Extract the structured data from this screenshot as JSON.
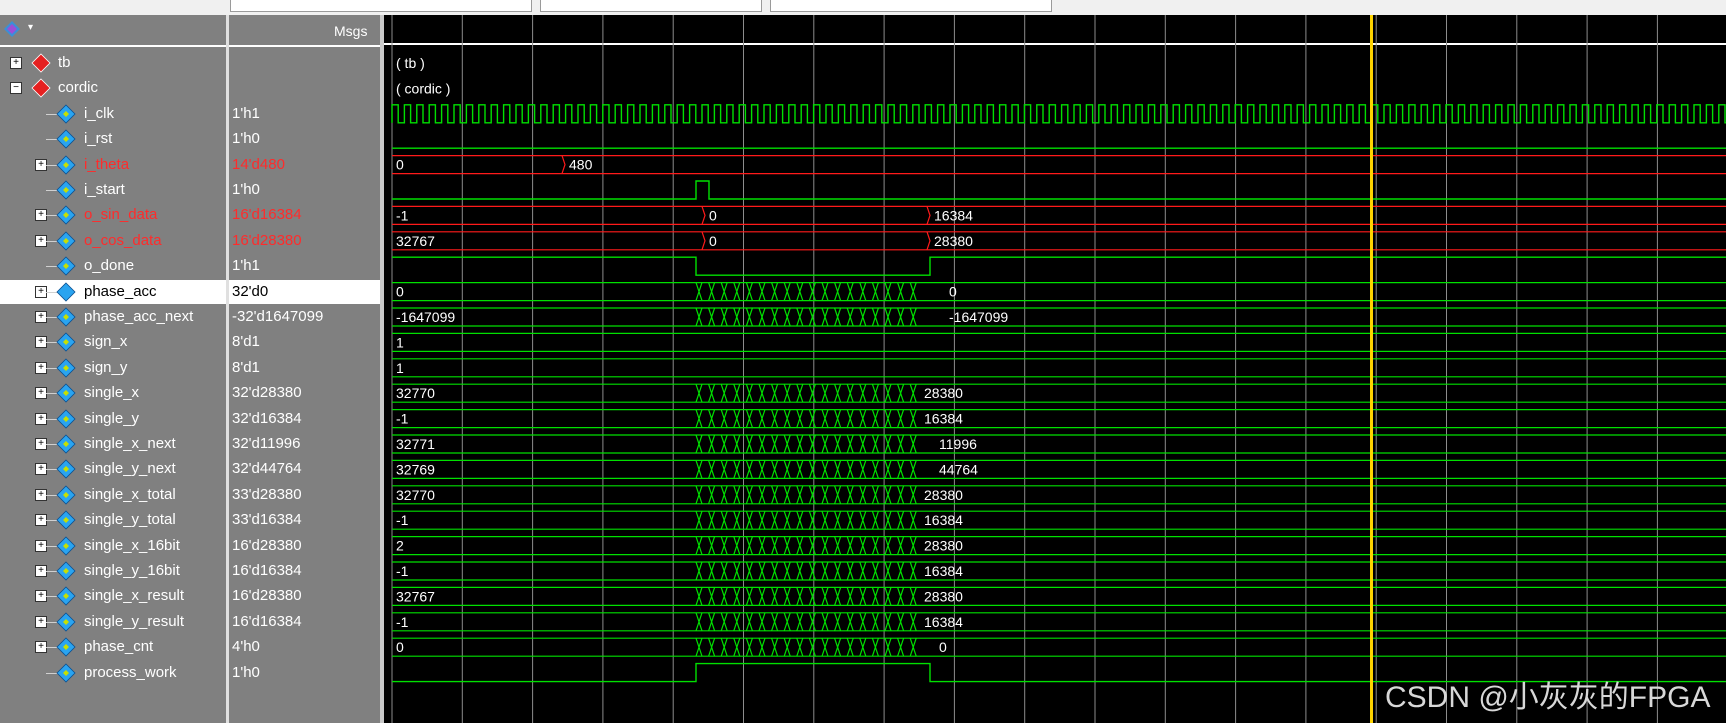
{
  "header": {
    "msgs_label": "Msgs"
  },
  "tree": [
    {
      "name": "tb",
      "value": "",
      "color": "white",
      "type": "instance",
      "depth": 0,
      "label": "( tb )"
    },
    {
      "name": "cordic",
      "value": "",
      "color": "white",
      "type": "instance",
      "depth": 0,
      "label": "( cordic )"
    },
    {
      "name": "i_clk",
      "value": "1'h1",
      "color": "white",
      "type": "clk",
      "depth": 1
    },
    {
      "name": "i_rst",
      "value": "1'h0",
      "color": "white",
      "type": "low",
      "depth": 1
    },
    {
      "name": "i_theta",
      "value": "14'd480",
      "color": "red",
      "type": "bus",
      "depth": 1,
      "segments": [
        {
          "label": "0",
          "start": 0
        },
        {
          "label": "480",
          "start": 565
        }
      ]
    },
    {
      "name": "i_start",
      "value": "1'h0",
      "color": "white",
      "type": "pulse",
      "depth": 1
    },
    {
      "name": "o_sin_data",
      "value": "16'd16384",
      "color": "red",
      "type": "bus",
      "depth": 1,
      "segments": [
        {
          "label": "-1",
          "start": 0
        },
        {
          "label": "0",
          "start": 705
        },
        {
          "label": "16384",
          "start": 930
        }
      ]
    },
    {
      "name": "o_cos_data",
      "value": "16'd28380",
      "color": "red",
      "type": "bus",
      "depth": 1,
      "segments": [
        {
          "label": "32767",
          "start": 0
        },
        {
          "label": "0",
          "start": 705
        },
        {
          "label": "28380",
          "start": 930
        }
      ]
    },
    {
      "name": "o_done",
      "value": "1'h1",
      "color": "white",
      "type": "done",
      "depth": 1
    },
    {
      "name": "phase_acc",
      "value": "32'd0",
      "color": "white",
      "type": "busy",
      "depth": 1,
      "selected": true,
      "segments": [
        {
          "label": "0",
          "start": 0
        },
        {
          "label": "0",
          "start": 945
        }
      ]
    },
    {
      "name": "phase_acc_next",
      "value": "-32'd1647099",
      "color": "white",
      "type": "busy",
      "depth": 1,
      "segments": [
        {
          "label": "-1647099",
          "start": 0
        },
        {
          "label": "-1647099",
          "start": 945
        }
      ]
    },
    {
      "name": "sign_x",
      "value": "8'd1",
      "color": "white",
      "type": "bus",
      "depth": 1,
      "segments": [
        {
          "label": "1",
          "start": 0
        }
      ]
    },
    {
      "name": "sign_y",
      "value": "8'd1",
      "color": "white",
      "type": "bus",
      "depth": 1,
      "segments": [
        {
          "label": "1",
          "start": 0
        }
      ]
    },
    {
      "name": "single_x",
      "value": "32'd28380",
      "color": "white",
      "type": "busy",
      "depth": 1,
      "segments": [
        {
          "label": "32770",
          "start": 0
        },
        {
          "label": "28380",
          "start": 920
        }
      ]
    },
    {
      "name": "single_y",
      "value": "32'd16384",
      "color": "white",
      "type": "busy",
      "depth": 1,
      "segments": [
        {
          "label": "-1",
          "start": 0
        },
        {
          "label": "16384",
          "start": 920
        }
      ]
    },
    {
      "name": "single_x_next",
      "value": "32'd11996",
      "color": "white",
      "type": "busy",
      "depth": 1,
      "segments": [
        {
          "label": "32771",
          "start": 0
        },
        {
          "label": "11996",
          "start": 935
        }
      ]
    },
    {
      "name": "single_y_next",
      "value": "32'd44764",
      "color": "white",
      "type": "busy",
      "depth": 1,
      "segments": [
        {
          "label": "32769",
          "start": 0
        },
        {
          "label": "44764",
          "start": 935
        }
      ]
    },
    {
      "name": "single_x_total",
      "value": "33'd28380",
      "color": "white",
      "type": "busy",
      "depth": 1,
      "segments": [
        {
          "label": "32770",
          "start": 0
        },
        {
          "label": "28380",
          "start": 920
        }
      ]
    },
    {
      "name": "single_y_total",
      "value": "33'd16384",
      "color": "white",
      "type": "busy",
      "depth": 1,
      "segments": [
        {
          "label": "-1",
          "start": 0
        },
        {
          "label": "16384",
          "start": 920
        }
      ]
    },
    {
      "name": "single_x_16bit",
      "value": "16'd28380",
      "color": "white",
      "type": "busy",
      "depth": 1,
      "segments": [
        {
          "label": "2",
          "start": 0
        },
        {
          "label": "28380",
          "start": 920
        }
      ]
    },
    {
      "name": "single_y_16bit",
      "value": "16'd16384",
      "color": "white",
      "type": "busy",
      "depth": 1,
      "segments": [
        {
          "label": "-1",
          "start": 0
        },
        {
          "label": "16384",
          "start": 920
        }
      ]
    },
    {
      "name": "single_x_result",
      "value": "16'd28380",
      "color": "white",
      "type": "busy",
      "depth": 1,
      "segments": [
        {
          "label": "32767",
          "start": 0
        },
        {
          "label": "28380",
          "start": 920
        }
      ]
    },
    {
      "name": "single_y_result",
      "value": "16'd16384",
      "color": "white",
      "type": "busy",
      "depth": 1,
      "segments": [
        {
          "label": "-1",
          "start": 0
        },
        {
          "label": "16384",
          "start": 920
        }
      ]
    },
    {
      "name": "phase_cnt",
      "value": "4'h0",
      "color": "white",
      "type": "busy",
      "depth": 1,
      "segments": [
        {
          "label": "0",
          "start": 0
        },
        {
          "label": "0",
          "start": 935
        }
      ]
    },
    {
      "name": "process_work",
      "value": "1'h0",
      "color": "white",
      "type": "work",
      "depth": 1
    }
  ],
  "watermark": "CSDN @小灰灰的FPGA",
  "colors": {
    "wave_green": "#00e000",
    "wave_red": "#ff1a1a",
    "cursor": "#ffd400",
    "grid": "#8c8c8c"
  }
}
